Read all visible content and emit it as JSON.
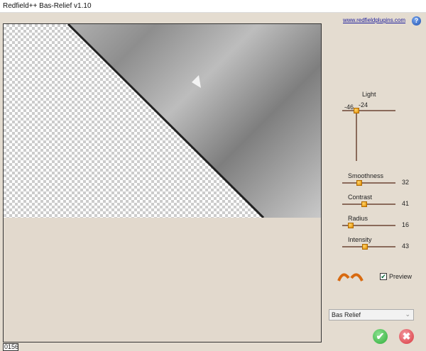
{
  "window": {
    "title": "Redfield++ Bas-Relief v1.10"
  },
  "header": {
    "link": "www.redfieldplugins.com",
    "help_icon": "help-icon"
  },
  "light": {
    "label": "Light",
    "x_value": "-46",
    "y_value": "-24"
  },
  "sliders": [
    {
      "label": "Smoothness",
      "value": "32",
      "fraction": 0.32
    },
    {
      "label": "Contrast",
      "value": "41",
      "fraction": 0.41
    },
    {
      "label": "Radius",
      "value": "16",
      "fraction": 0.16
    },
    {
      "label": "Intensity",
      "value": "43",
      "fraction": 0.43
    }
  ],
  "preview_checkbox": {
    "label": "Preview",
    "checked": true
  },
  "mode_select": {
    "value": "Bas Relief"
  },
  "status": {
    "text": "0156"
  },
  "colors": {
    "background": "#e4dcd0",
    "knob": "#f0a000",
    "ok": "#2fae3a",
    "cancel": "#d9383f"
  }
}
